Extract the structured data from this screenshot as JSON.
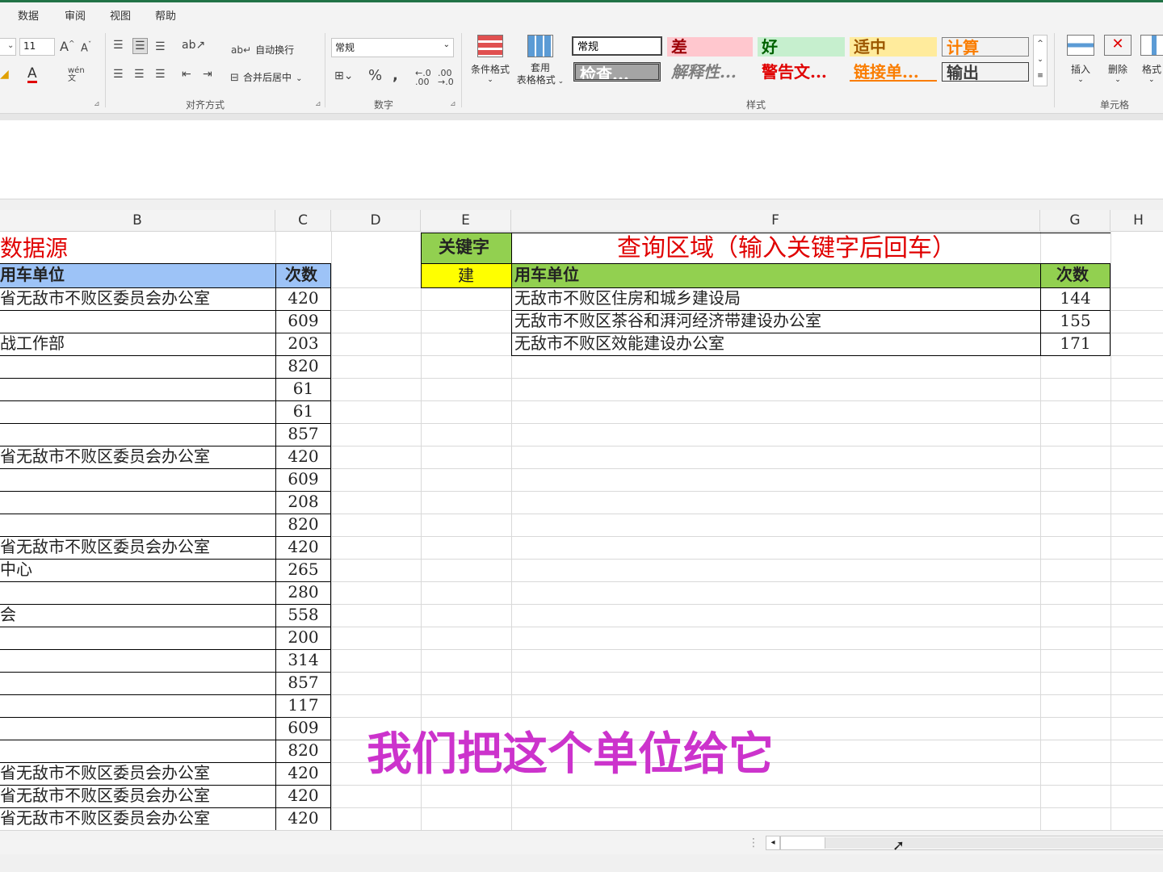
{
  "menu": {
    "data": "数据",
    "review": "审阅",
    "view": "视图",
    "help": "帮助"
  },
  "ribbon": {
    "font_size": "11",
    "wrap_text": "自动换行",
    "merge_center": "合并后居中",
    "number_format": "常规",
    "conditional_format": "条件格式",
    "table_format_1": "套用",
    "table_format_2": "表格格式",
    "styles": [
      "常规",
      "差",
      "好",
      "适中",
      "计算",
      "检查...",
      "解释性...",
      "警告文...",
      "链接单...",
      "输出"
    ],
    "insert": "插入",
    "delete": "删除",
    "format": "格式",
    "groups": {
      "align": "对齐方式",
      "number": "数字",
      "styles": "样式",
      "cells": "单元格"
    }
  },
  "columns": [
    "B",
    "C",
    "D",
    "E",
    "F",
    "G",
    "H"
  ],
  "source": {
    "title": "数据源",
    "header_unit": "用车单位",
    "header_count": "次数",
    "rows": [
      {
        "unit": "省无敌市不败区委员会办公室",
        "count": "420"
      },
      {
        "unit": "",
        "count": "609"
      },
      {
        "unit": "战工作部",
        "count": "203"
      },
      {
        "unit": "",
        "count": "820"
      },
      {
        "unit": "",
        "count": "61"
      },
      {
        "unit": "",
        "count": "61"
      },
      {
        "unit": "",
        "count": "857"
      },
      {
        "unit": "省无敌市不败区委员会办公室",
        "count": "420"
      },
      {
        "unit": "",
        "count": "609"
      },
      {
        "unit": "",
        "count": "208"
      },
      {
        "unit": "",
        "count": "820"
      },
      {
        "unit": "省无敌市不败区委员会办公室",
        "count": "420"
      },
      {
        "unit": "中心",
        "count": "265"
      },
      {
        "unit": "",
        "count": "280"
      },
      {
        "unit": "会",
        "count": "558"
      },
      {
        "unit": "",
        "count": "200"
      },
      {
        "unit": "",
        "count": "314"
      },
      {
        "unit": "",
        "count": "857"
      },
      {
        "unit": "",
        "count": "117"
      },
      {
        "unit": "",
        "count": "609"
      },
      {
        "unit": "",
        "count": "820"
      },
      {
        "unit": "省无敌市不败区委员会办公室",
        "count": "420"
      },
      {
        "unit": "省无敌市不败区委员会办公室",
        "count": "420"
      },
      {
        "unit": "省无敌市不败区委员会办公室",
        "count": "420"
      }
    ]
  },
  "query": {
    "keyword_label": "关键字",
    "keyword_value": "建",
    "title": "查询区域（输入关键字后回车）",
    "header_unit": "用车单位",
    "header_count": "次数",
    "rows": [
      {
        "unit": "无敌市不败区住房和城乡建设局",
        "count": "144"
      },
      {
        "unit": "无敌市不败区茶谷和湃河经济带建设办公室",
        "count": "155"
      },
      {
        "unit": "无敌市不败区效能建设办公室",
        "count": "171"
      }
    ]
  },
  "subtitle": "我们把这个单位给它",
  "colors": {
    "red": "#e00000",
    "blue_header": "#9dc3f7",
    "green_header": "#92d050",
    "yellow": "#ffff00",
    "subtitle": "#cc33cc"
  }
}
